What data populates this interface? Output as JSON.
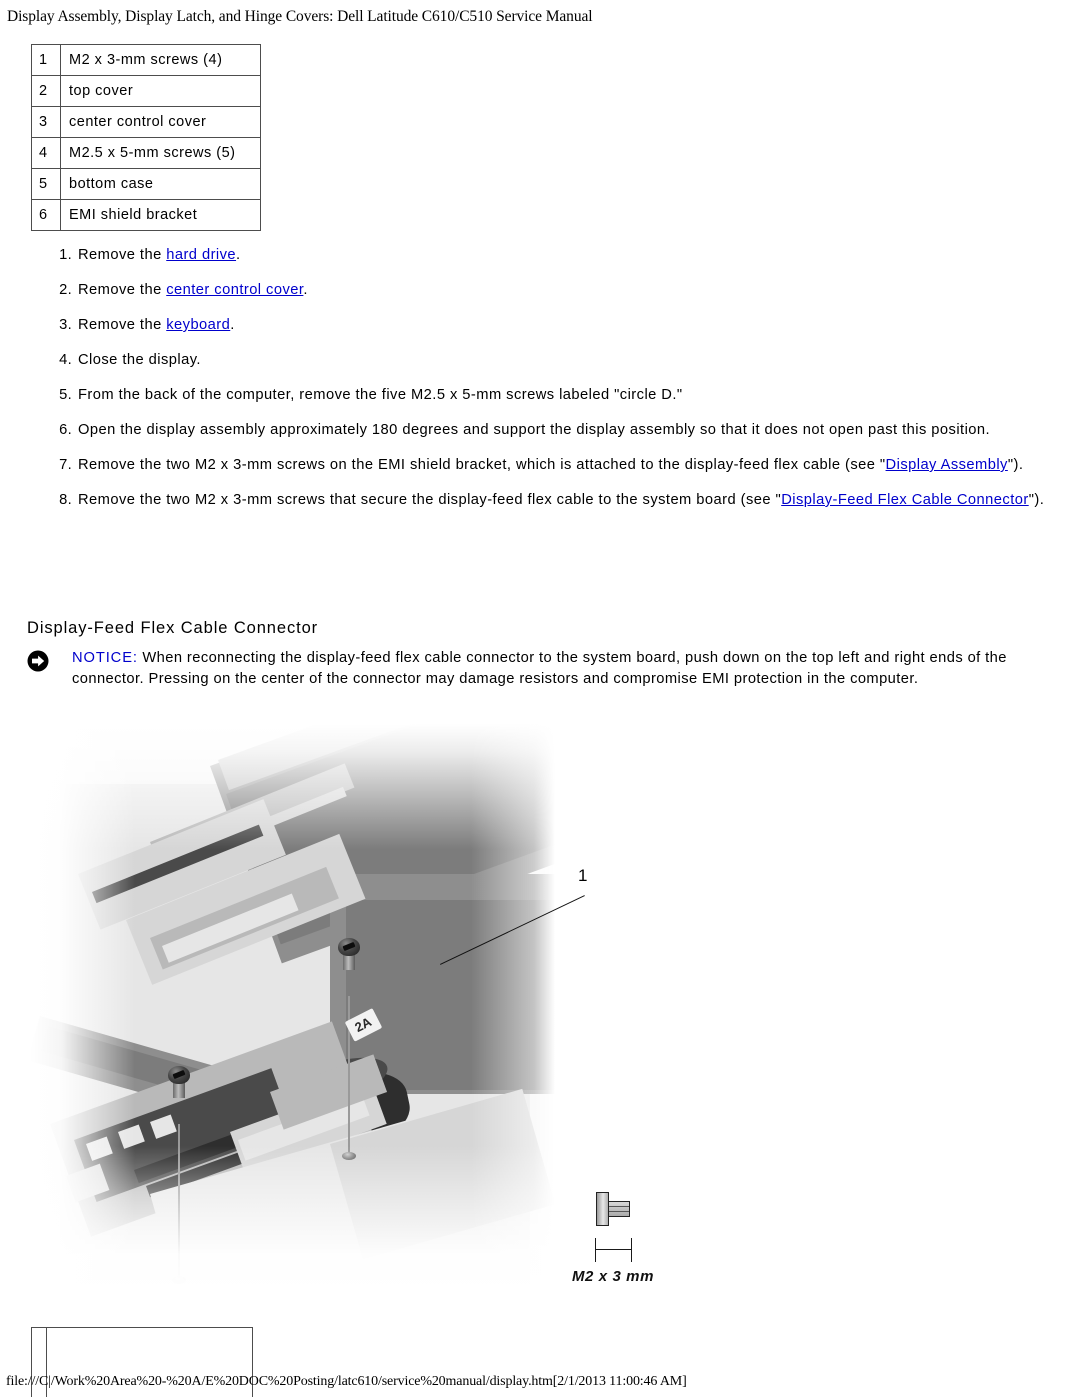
{
  "document": {
    "title": "Display Assembly, Display Latch, and Hinge Covers: Dell Latitude C610/C510 Service Manual",
    "footer_url": "file:///C|/Work%20Area%20-%20A/E%20DOC%20Posting/latc610/service%20manual/display.htm[2/1/2013 11:00:46 AM]"
  },
  "legend_table": {
    "rows": [
      {
        "num": "1",
        "label": "M2 x 3-mm screws (4)"
      },
      {
        "num": "2",
        "label": "top cover"
      },
      {
        "num": "3",
        "label": "center control cover"
      },
      {
        "num": "4",
        "label": "M2.5 x 5-mm screws (5)"
      },
      {
        "num": "5",
        "label": "bottom case"
      },
      {
        "num": "6",
        "label": "EMI shield bracket"
      }
    ]
  },
  "procedure": {
    "steps": [
      {
        "marker": "1.",
        "lead": "Remove the ",
        "link": "hard drive",
        "tail": "."
      },
      {
        "marker": "2.",
        "lead": "Remove the ",
        "link": "center control cover",
        "tail": "."
      },
      {
        "marker": "3.",
        "lead": "Remove the ",
        "link": "keyboard",
        "tail": "."
      },
      {
        "marker": "4.",
        "lead": "Close the display.",
        "link": "",
        "tail": ""
      },
      {
        "marker": "5.",
        "lead": "From the back of the computer, remove the five M2.5 x 5-mm screws labeled \"circle D.\"",
        "link": "",
        "tail": ""
      },
      {
        "marker": "6.",
        "lead": "Open the display assembly approximately 180 degrees and support the display assembly so that it does not open past this position.",
        "link": "",
        "tail": ""
      },
      {
        "marker": "7.",
        "lead": "Remove the two M2 x 3-mm screws on the EMI shield bracket, which is attached to the display-feed flex cable (see \"",
        "link": "Display Assembly",
        "tail": "\")."
      },
      {
        "marker": "8.",
        "lead": "Remove the two M2 x 3-mm screws that secure the display-feed flex cable to the system board (see \"",
        "link": "Display-Feed Flex Cable Connector",
        "tail": "\")."
      }
    ]
  },
  "section": {
    "heading": "Display-Feed Flex Cable Connector"
  },
  "notice": {
    "icon": "notice-arrow-icon",
    "label": "NOTICE:",
    "text": " When reconnecting the display-feed flex cable connector to the system board, push down on the top left and right ends of the connector. Pressing on the center of the connector may damage resistors and compromise EMI protection in the computer."
  },
  "figure": {
    "callouts": [
      {
        "number": "1"
      }
    ],
    "component_label": "2A",
    "screw_legend": {
      "icon": "screw-side-view-icon",
      "dimension_icon": "length-dimension-icon",
      "caption": "M2 x 3 mm"
    }
  },
  "colors": {
    "link": "#0000cc",
    "notice_label": "#0000cc",
    "text": "#000000",
    "table_border": "#4d4d4d",
    "background": "#ffffff"
  }
}
